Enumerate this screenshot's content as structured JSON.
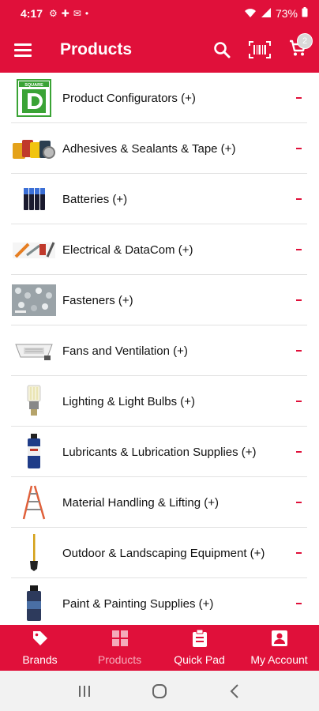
{
  "status_bar": {
    "time": "4:17",
    "battery": "73%"
  },
  "app_bar": {
    "title": "Products",
    "cart_count": "2"
  },
  "products": [
    {
      "label": "Product Configurators (+)",
      "icon": "square-d-logo"
    },
    {
      "label": "Adhesives & Sealants & Tape (+)",
      "icon": "adhesives-tape-image"
    },
    {
      "label": "Batteries  (+)",
      "icon": "batteries-image"
    },
    {
      "label": "Electrical & DataCom (+)",
      "icon": "electrical-tools-image"
    },
    {
      "label": "Fasteners (+)",
      "icon": "fasteners-image"
    },
    {
      "label": "Fans and Ventilation (+)",
      "icon": "ceiling-fan-image"
    },
    {
      "label": "Lighting & Light Bulbs (+)",
      "icon": "light-bulb-image"
    },
    {
      "label": "Lubricants & Lubrication Supplies (+)",
      "icon": "spray-can-image"
    },
    {
      "label": "Material Handling & Lifting (+)",
      "icon": "ladder-image"
    },
    {
      "label": "Outdoor & Landscaping Equipment (+)",
      "icon": "shovel-image"
    },
    {
      "label": "Paint & Painting Supplies (+)",
      "icon": "spray-paint-image"
    }
  ],
  "bottom_nav": [
    {
      "label": "Brands",
      "icon": "tag-icon"
    },
    {
      "label": "Products",
      "icon": "grid-icon"
    },
    {
      "label": "Quick Pad",
      "icon": "clipboard-icon"
    },
    {
      "label": "My Account",
      "icon": "account-icon"
    }
  ],
  "colors": {
    "brand_red": "#e0103a"
  }
}
